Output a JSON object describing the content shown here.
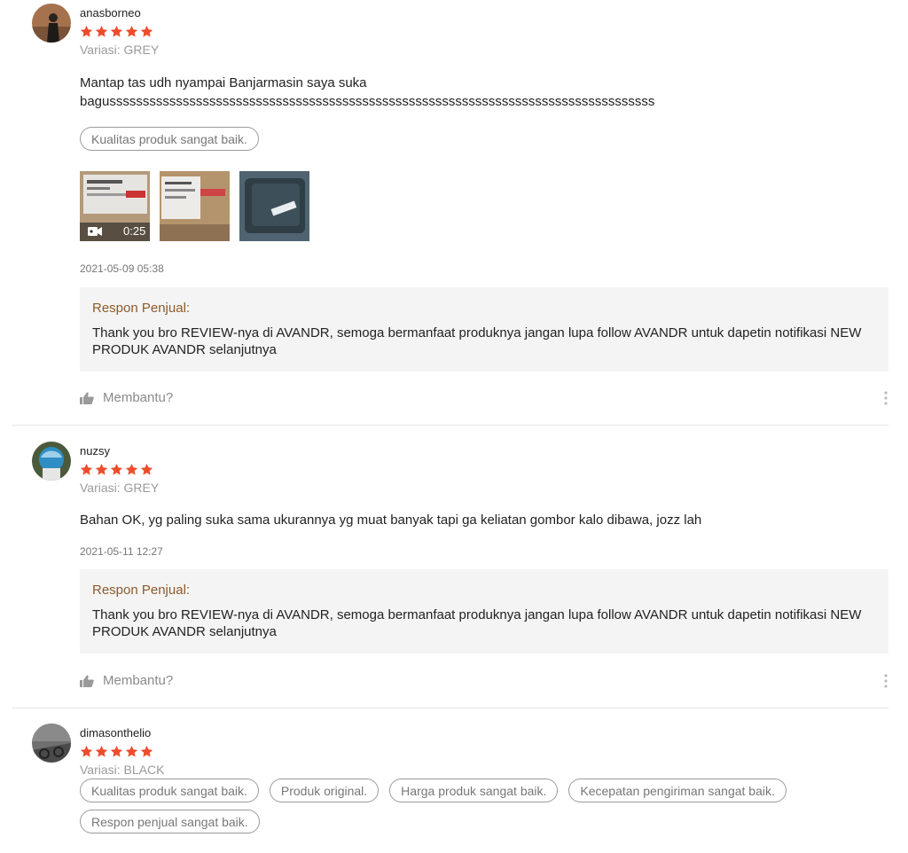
{
  "reviews": [
    {
      "username": "anasborneo",
      "rating": 5,
      "variation": "Variasi: GREY",
      "comment_line1": "Mantap tas udh nyampai Banjarmasin saya suka",
      "comment_line2": "bagussssssssssssssssssssssssssssssssssssssssssssssssssssssssssssssssssssssssssssssssss",
      "tags": [
        "Kualitas produk sangat baik."
      ],
      "video_duration": "0:25",
      "date": "2021-05-09 05:38",
      "seller_title": "Respon Penjual:",
      "seller_text": "Thank you bro REVIEW-nya di AVANDR, semoga bermanfaat produknya jangan lupa follow AVANDR untuk dapetin notifikasi NEW PRODUK AVANDR selanjutnya",
      "helpful_label": "Membantu?"
    },
    {
      "username": "nuzsy",
      "rating": 5,
      "variation": "Variasi: GREY",
      "comment_line1": "Bahan OK, yg paling suka sama ukurannya yg muat banyak tapi ga keliatan gombor kalo dibawa, jozz lah",
      "date": "2021-05-11 12:27",
      "seller_title": "Respon Penjual:",
      "seller_text": "Thank you bro REVIEW-nya di AVANDR, semoga bermanfaat produknya jangan lupa follow AVANDR untuk dapetin notifikasi NEW PRODUK AVANDR selanjutnya",
      "helpful_label": "Membantu?"
    },
    {
      "username": "dimasonthelio",
      "rating": 5,
      "variation": "Variasi: BLACK",
      "tags": [
        "Kualitas produk sangat baik.",
        "Produk original.",
        "Harga produk sangat baik.",
        "Kecepatan pengiriman sangat baik.",
        "Respon penjual sangat baik."
      ]
    }
  ],
  "colors": {
    "star": "#ee4d2d",
    "seller_title": "#8b5a2b",
    "seller_bg": "#f4f4f4"
  },
  "icons": {
    "thumb": "thumbs-up-icon",
    "more": "more-vertical-icon",
    "video": "video-camera-icon"
  }
}
